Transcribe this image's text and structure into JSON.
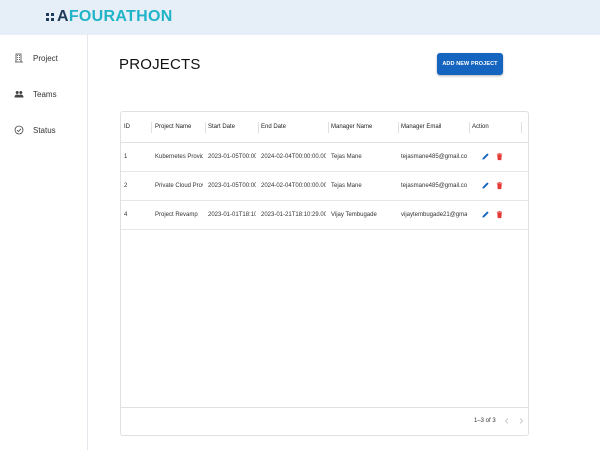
{
  "header": {
    "logo_text_a": "A",
    "logo_text_rest": "FOURATHON"
  },
  "sidebar": {
    "items": [
      {
        "label": "Project",
        "icon": "building-icon"
      },
      {
        "label": "Teams",
        "icon": "people-icon"
      },
      {
        "label": "Status",
        "icon": "check-circle-icon"
      }
    ]
  },
  "main": {
    "title": "PROJECTS",
    "add_button_label": "ADD NEW PROJECT"
  },
  "table": {
    "columns": [
      "ID",
      "Project Name",
      "Start Date",
      "End Date",
      "Manager Name",
      "Manager Email",
      "Action"
    ],
    "rows": [
      {
        "id": "1",
        "name": "Kubernetes Provid...",
        "start": "2023-01-05T00:00:...",
        "end": "2024-02-04T00:00:00.000Z",
        "manager": "Tejas Mane",
        "email": "tejasmane485@gmail.com"
      },
      {
        "id": "2",
        "name": "Private Cloud Provi...",
        "start": "2023-01-05T00:00:...",
        "end": "2024-02-04T00:00:00.000Z",
        "manager": "Tejas Mane",
        "email": "tejasmane485@gmail.com"
      },
      {
        "id": "4",
        "name": "Project Revamp",
        "start": "2023-01-01T18:10:...",
        "end": "2023-01-21T18:10:29.000Z",
        "manager": "Vijay Tembugade",
        "email": "vijaytembugade21@gmail...."
      }
    ],
    "pagination": "1–3 of 3"
  },
  "colors": {
    "header_bg": "#e6eef7",
    "brand_teal": "#20b4c8",
    "brand_navy": "#1f3b5a",
    "primary": "#1565c0",
    "delete": "#e53935"
  }
}
